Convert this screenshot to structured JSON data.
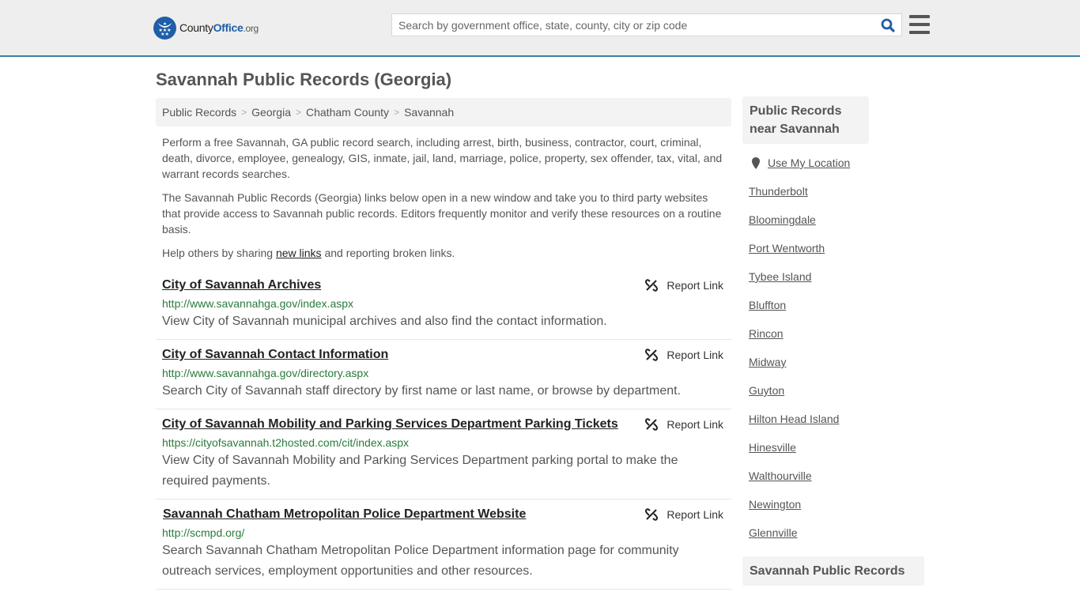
{
  "header": {
    "logo": {
      "prefix": "County",
      "brand": "Office",
      "tld": ".org"
    },
    "search": {
      "placeholder": "Search by government office, state, county, city or zip code",
      "value": ""
    },
    "icons": {
      "search": "search-icon",
      "menu": "hamburger-menu-icon"
    }
  },
  "page": {
    "title": "Savannah Public Records (Georgia)"
  },
  "breadcrumb": [
    {
      "label": "Public Records"
    },
    {
      "label": "Georgia"
    },
    {
      "label": "Chatham County"
    },
    {
      "label": "Savannah"
    }
  ],
  "intro": {
    "p1": "Perform a free Savannah, GA public record search, including arrest, birth, business, contractor, court, criminal, death, divorce, employee, genealogy, GIS, inmate, jail, land, marriage, police, property, sex offender, tax, vital, and warrant records searches.",
    "p2": "The Savannah Public Records (Georgia) links below open in a new window and take you to third party websites that provide access to Savannah public records. Editors frequently monitor and verify these resources on a routine basis.",
    "p3_before": "Help others by sharing ",
    "p3_link": "new links",
    "p3_after": " and reporting broken links."
  },
  "records": [
    {
      "title": "City of Savannah Archives",
      "url": "http://www.savannahga.gov/index.aspx",
      "description": "View City of Savannah municipal archives and also find the contact information.",
      "report": "Report Link"
    },
    {
      "title": "City of Savannah Contact Information",
      "url": "http://www.savannahga.gov/directory.aspx",
      "description": "Search City of Savannah staff directory by first name or last name, or browse by department.",
      "report": "Report Link"
    },
    {
      "title": "City of Savannah Mobility and Parking Services Department Parking Tickets",
      "url": "https://cityofsavannah.t2hosted.com/cit/index.aspx",
      "description": "View City of Savannah Mobility and Parking Services Department parking portal to make the required payments.",
      "report": "Report Link"
    },
    {
      "title": "Savannah Chatham Metropolitan Police Department Website",
      "url": "http://scmpd.org/",
      "description": "Search Savannah Chatham Metropolitan Police Department information page for community outreach services, employment opportunities and other resources.",
      "report": "Report Link"
    }
  ],
  "sidebar": {
    "heading": "Public Records near Savannah",
    "use_location": "Use My Location",
    "places": [
      "Thunderbolt",
      "Bloomingdale",
      "Port Wentworth",
      "Tybee Island",
      "Bluffton",
      "Rincon",
      "Midway",
      "Guyton",
      "Hilton Head Island",
      "Hinesville",
      "Walthourville",
      "Newington",
      "Glennville"
    ],
    "heading2": "Savannah Public Records"
  },
  "colors": {
    "accent": "#1f5ea8",
    "header_border": "#3a7ead",
    "url_green": "#2a7a3a"
  }
}
